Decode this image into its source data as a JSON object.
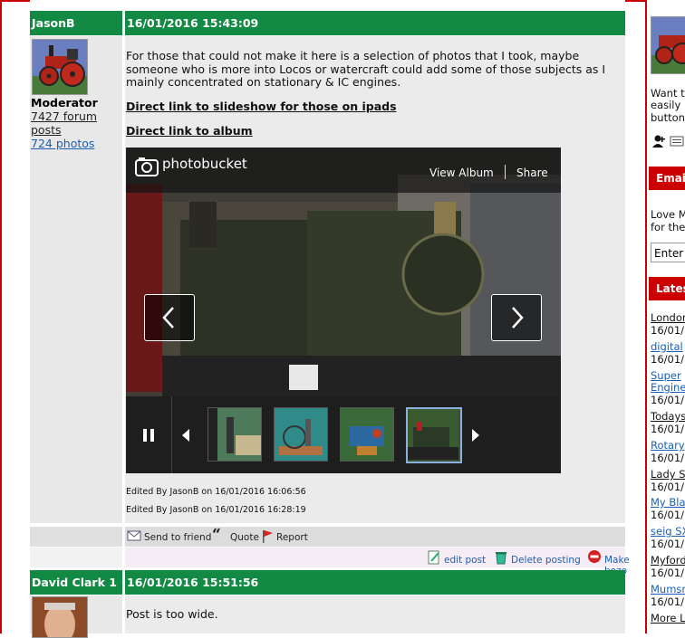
{
  "post1": {
    "author": "JasonB",
    "date": "16/01/2016 15:43:09",
    "role": "Moderator",
    "forum_posts": "7427 forum posts",
    "photos": "724 photos",
    "message": "For those that could not make it here is a selection of photos that I took, maybe someone who is more into Locos or watercraft could add some of those subjects as I mainly concentrated on stationary & IC engines.",
    "link1": "Direct link to slideshow for those on ipads",
    "link2": "Direct link to album",
    "viewer": {
      "logo": "photobucket",
      "view_album": "View Album",
      "share": "Share",
      "prev_icon": "chevron-left-icon",
      "next_icon": "chevron-right-icon",
      "pause_icon": "pause-icon"
    },
    "edited1": "Edited By JasonB on 16/01/2016 16:06:56",
    "edited2": "Edited By JasonB on 16/01/2016 16:28:19",
    "actions": {
      "send": "Send to friend",
      "quote": "Quote",
      "report": "Report"
    },
    "mod_actions": {
      "edit": "edit post",
      "delete": "Delete posting",
      "bozo": "Make bozo"
    }
  },
  "post2": {
    "author": "David Clark 1",
    "date": "16/01/2016 15:51:56",
    "message": "Post is too wide."
  },
  "sidebar": {
    "promo_lines": [
      "Want t",
      "easily",
      "button"
    ],
    "email_header": "Email",
    "email_lines": [
      "Love M",
      "for the"
    ],
    "email_input": "Enter",
    "latest_header": "Lates",
    "latest": [
      {
        "title": "London",
        "date": "16/01/",
        "style": "dark"
      },
      {
        "title": "digital",
        "date": "16/01/",
        "style": "blue"
      },
      {
        "title": "Super",
        "title2": "Engine",
        "date": "16/01/",
        "style": "blue"
      },
      {
        "title": "Todays",
        "date": "16/01/",
        "style": "dark"
      },
      {
        "title": "Rotary",
        "date": "16/01/",
        "style": "blue"
      },
      {
        "title": "Lady S",
        "date": "16/01/",
        "style": "dark"
      },
      {
        "title": "My Bla",
        "date": "16/01/",
        "style": "blue"
      },
      {
        "title": "seig SX",
        "date": "16/01/",
        "style": "blue"
      },
      {
        "title": "Myford",
        "date": "16/01/",
        "style": "dark"
      },
      {
        "title": "Mumsn",
        "date": "16/01/",
        "style": "blue"
      }
    ],
    "more": "More L"
  },
  "colors": {
    "header_green": "#128a43",
    "frame_red": "#cc0000",
    "link_blue": "#1a5fb4"
  }
}
